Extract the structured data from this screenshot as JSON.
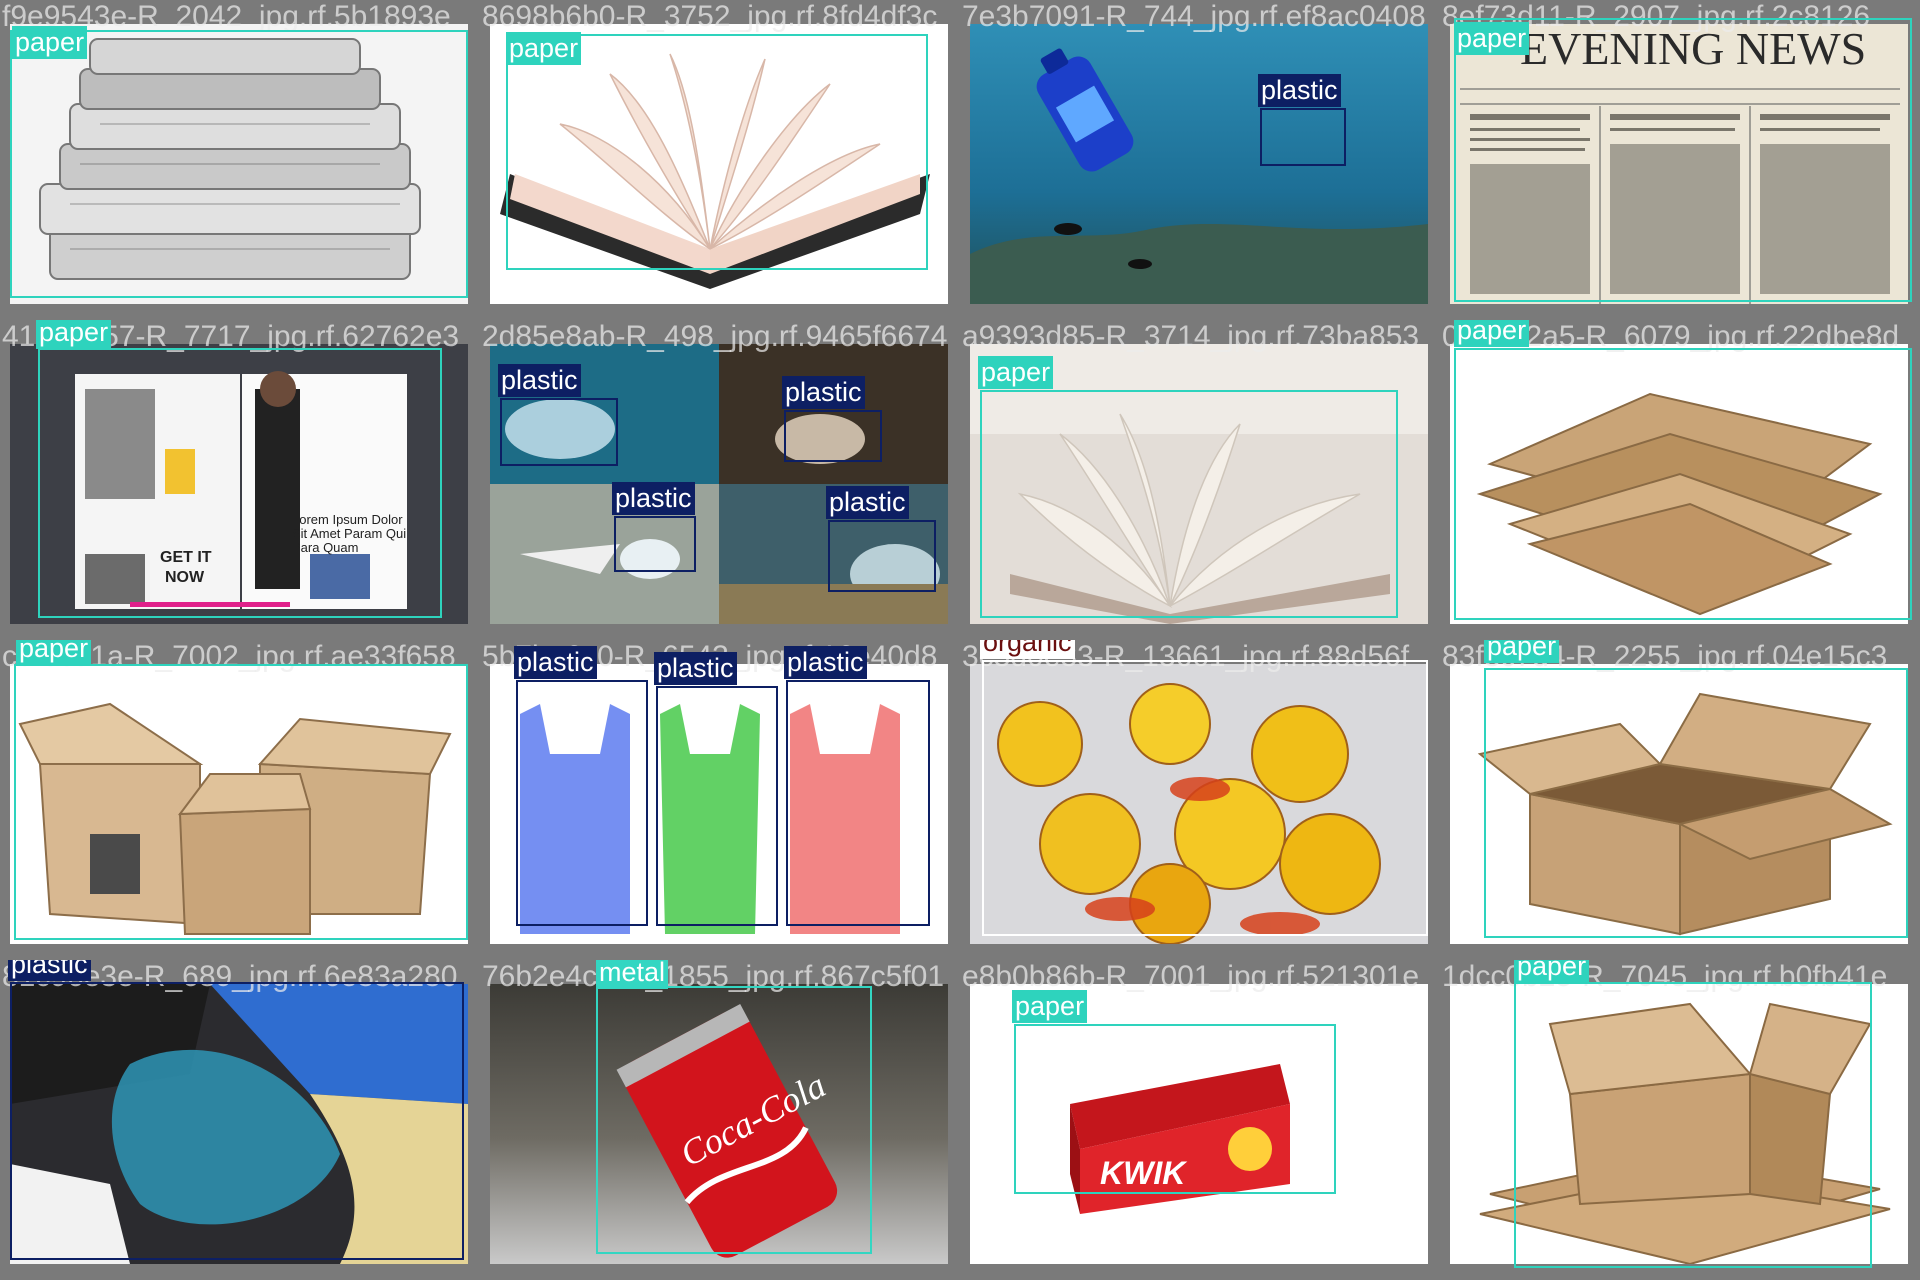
{
  "colors": {
    "paper": "#2ed3bd",
    "plastic": "#0d1f63",
    "metal": "#33d6c2",
    "organic": "#ffffff",
    "organic_text": "#6b0f0f",
    "filename_text": "#e6e6e6",
    "grid_bg": "#727272"
  },
  "tiles": [
    {
      "filename": "f9e9543e-R_2042_jpg.rf.5b1893e",
      "scene": "Stack of folded newspapers",
      "detections": [
        {
          "label": "paper"
        }
      ]
    },
    {
      "filename": "8698b6b0-R_3752_jpg.rf.8fd4df3c",
      "scene": "Open book with fanned pages",
      "detections": [
        {
          "label": "paper"
        }
      ]
    },
    {
      "filename": "7e3b7091-R_744_jpg.rf.ef8ac0408",
      "scene": "Plastic bottle floating underwater",
      "detections": [
        {
          "label": "plastic"
        }
      ]
    },
    {
      "filename": "8ef73d11-R_2907_jpg.rf.2c8126",
      "scene": "Old newspaper front page",
      "detections": [
        {
          "label": "paper"
        }
      ]
    },
    {
      "filename": "41daab57-R_7717_jpg.rf.62762e3",
      "scene": "Open fashion magazine",
      "detections": [
        {
          "label": "paper"
        }
      ]
    },
    {
      "filename": "2d85e8ab-R_498_jpg.rf.9465f6674",
      "scene": "Collage of plastic waste in the ocean",
      "detections": [
        {
          "label": "plastic"
        },
        {
          "label": "plastic"
        },
        {
          "label": "plastic"
        },
        {
          "label": "plastic"
        }
      ]
    },
    {
      "filename": "a9393d85-R_3714_jpg.rf.73ba853",
      "scene": "Open book on a bed",
      "detections": [
        {
          "label": "paper"
        }
      ]
    },
    {
      "filename": "0b5822a5-R_6079_jpg.rf.22dbe8d",
      "scene": "Pile of flattened cardboard",
      "detections": [
        {
          "label": "paper"
        }
      ]
    },
    {
      "filename": "c9fecd1a-R_7002_jpg.rf.ae33f658",
      "scene": "Group of open cardboard boxes",
      "detections": [
        {
          "label": "paper"
        }
      ]
    },
    {
      "filename": "5b7be6c0-R_6543_jpg.rf.16e40d8",
      "scene": "Three coloured plastic bags",
      "detections": [
        {
          "label": "plastic"
        },
        {
          "label": "plastic"
        },
        {
          "label": "plastic"
        }
      ]
    },
    {
      "filename": "3c3d0e33-R_13661_jpg.rf.88d56f",
      "scene": "Yellow fruit peels",
      "detections": [
        {
          "label": "organic"
        }
      ]
    },
    {
      "filename": "83f8c7d4-R_2255_jpg.rf.04e15c3",
      "scene": "Single open cardboard box",
      "detections": [
        {
          "label": "paper"
        }
      ]
    },
    {
      "filename": "81c96e3e-R_689_jpg.rf.6e83a280",
      "scene": "Heap of plastic bags",
      "detections": [
        {
          "label": "plastic"
        }
      ]
    },
    {
      "filename": "76b2e4cd-R_1855_jpg.rf.867c5f01",
      "scene": "Crushed Coca-Cola can",
      "detections": [
        {
          "label": "metal"
        }
      ]
    },
    {
      "filename": "e8b0b86b-R_7001_jpg.rf.521301e",
      "scene": "Kwik product carton",
      "detections": [
        {
          "label": "paper"
        }
      ],
      "brand_text": "KWIK"
    },
    {
      "filename": "1dcc0b25-R_7045_jpg.rf.b0fb41e",
      "scene": "Cardboard box on flat sheets",
      "detections": [
        {
          "label": "paper"
        }
      ]
    }
  ]
}
